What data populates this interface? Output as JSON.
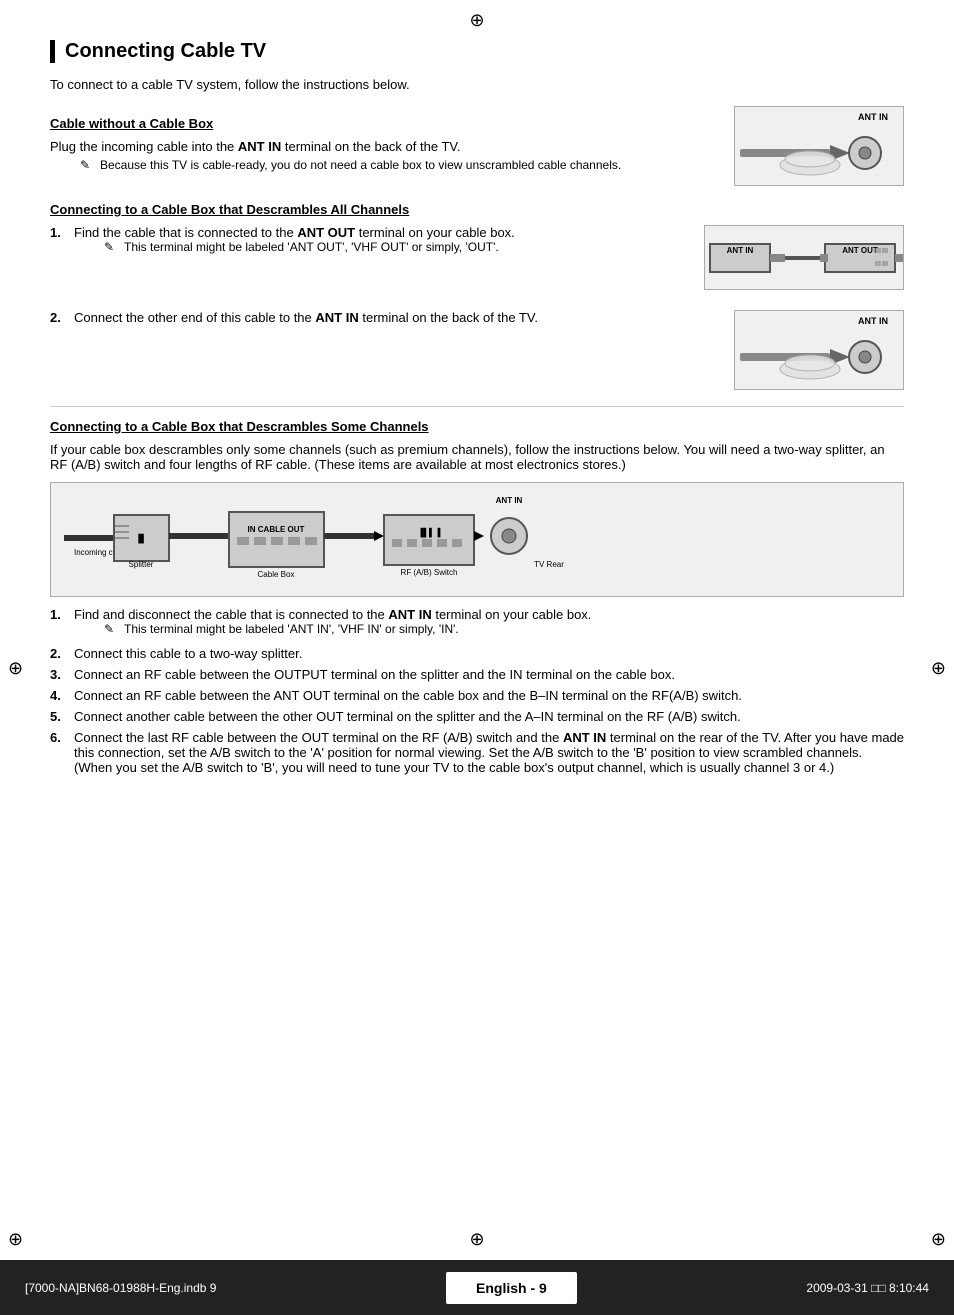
{
  "page": {
    "title": "Connecting Cable TV",
    "intro": "To connect to a cable TV system, follow the instructions below.",
    "section1": {
      "title": "Cable without a Cable Box",
      "body": "Plug the incoming cable into the ANT IN terminal on the back of the TV.",
      "body_bold_part": "ANT IN",
      "note": "Because this TV is cable-ready, you do not need a cable box to view unscrambled cable channels."
    },
    "section2": {
      "title": "Connecting to a Cable Box that Descrambles All Channels",
      "step1": "Find the cable that is connected to the ANT OUT terminal on your cable box.",
      "step1_bold": "ANT OUT",
      "step1_note": "This terminal might be labeled 'ANT OUT', 'VHF OUT' or simply, 'OUT'.",
      "step2": "Connect the other end of this cable to the ANT IN terminal on the back of the TV.",
      "step2_bold": "ANT IN"
    },
    "section3": {
      "title": "Connecting to a Cable Box that Descrambles Some Channels",
      "intro": "If your cable box descrambles only some channels (such as premium channels), follow the instructions below. You will need a two-way splitter, an RF (A/B) switch and four lengths of RF cable. (These items are available at most electronics stores.)",
      "steps": [
        "Find and disconnect the cable that is connected to the ANT IN terminal on your cable box.",
        "Connect this cable to a two-way splitter.",
        "Connect an RF cable between the OUTPUT terminal on the splitter and the IN terminal on the cable box.",
        "Connect an RF cable between the ANT OUT terminal on the cable box and the B–IN terminal on the RF(A/B) switch.",
        "Connect another cable between the other OUT terminal on the splitter and the A–IN terminal on the RF (A/B) switch.",
        "Connect the last RF cable between the OUT terminal on the RF (A/B) switch and the ANT IN terminal on the rear of the TV. After you have made this connection, set the A/B switch to the 'A' position for normal viewing. Set the A/B switch to the 'B' position to view scrambled channels. (When you set the A/B switch to 'B', you will need to tune your TV to the cable box's output channel, which is usually channel 3 or 4.)"
      ],
      "step1_note": "This terminal might be labeled 'ANT IN', 'VHF IN' or simply, 'IN'.",
      "step1_bold": "ANT IN",
      "step6_bold": "ANT IN",
      "diagram_labels": {
        "incoming_cable": "Incoming cable",
        "splitter": "Splitter",
        "cable_box": "Cable Box",
        "rf_switch": "RF (A/B) Switch",
        "tv_rear": "TV Rear",
        "ant_in": "ANT IN",
        "cable_label": "CABLE",
        "in_label": "IN",
        "out_label": "OUT"
      }
    },
    "footer": {
      "left": "[7000-NA]BN68-01988H-Eng.indb   9",
      "center": "English - 9",
      "right": "2009-03-31   □□ 8:10:44"
    }
  }
}
